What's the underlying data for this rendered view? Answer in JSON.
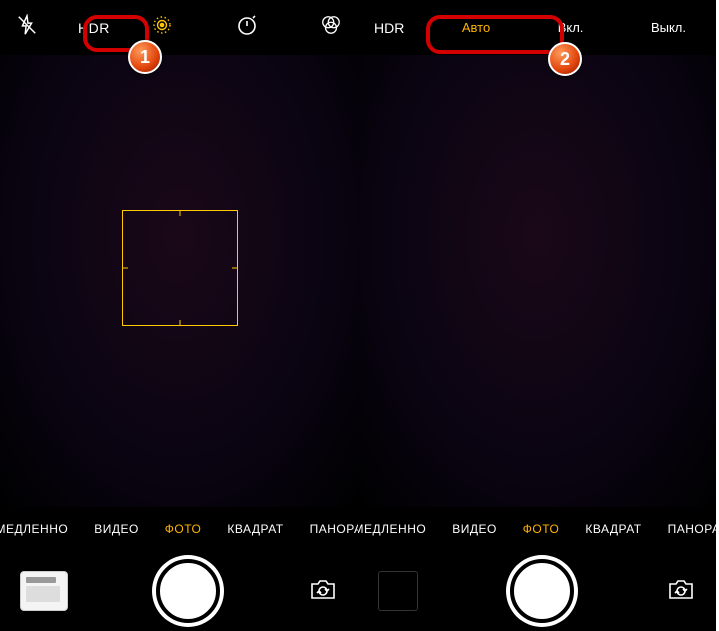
{
  "left": {
    "top": {
      "hdr_label": "HDR"
    },
    "modes": [
      "МЕДЛЕННО",
      "ВИДЕО",
      "ФОТО",
      "КВАДРАТ",
      "ПАНОРА"
    ],
    "active_mode_index": 2
  },
  "right": {
    "top": {
      "hdr_label": "HDR",
      "options": [
        "Авто",
        "Вкл.",
        "Выкл."
      ],
      "active_option_index": 0
    },
    "modes": [
      "МЕДЛЕННО",
      "ВИДЕО",
      "ФОТО",
      "КВАДРАТ",
      "ПАНОРА"
    ],
    "active_mode_index": 2
  },
  "callouts": {
    "first": "1",
    "second": "2"
  }
}
